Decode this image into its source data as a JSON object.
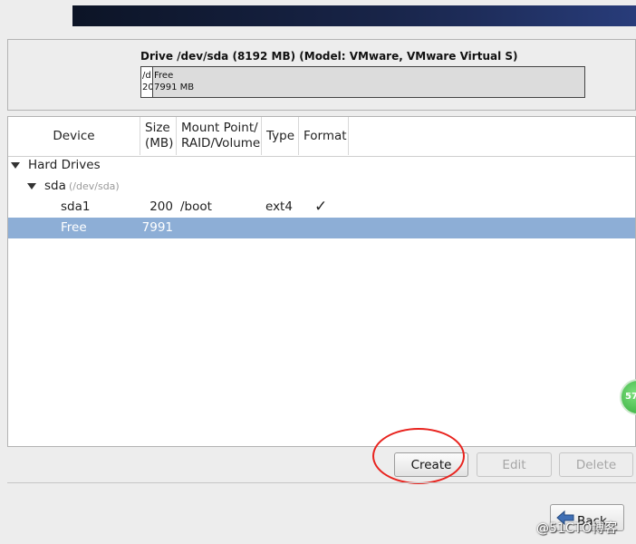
{
  "drive": {
    "title": "Drive /dev/sda (8192 MB) (Model: VMware, VMware Virtual S)",
    "bar": {
      "sda1_top": "/d",
      "sda1_bottom": "20",
      "free_top": "Free",
      "free_bottom": "7991 MB"
    }
  },
  "table": {
    "headers": {
      "device": "Device",
      "size_line1": "Size",
      "size_line2": "(MB)",
      "mount_line1": "Mount Point/",
      "mount_line2": "RAID/Volume",
      "type": "Type",
      "format": "Format"
    },
    "rows": {
      "hard_drives": "Hard Drives",
      "sda": {
        "name": "sda",
        "path": "(/dev/sda)"
      },
      "sda1": {
        "device": "sda1",
        "size": "200",
        "mount": "/boot",
        "type": "ext4",
        "format": "✓"
      },
      "free": {
        "device": "Free",
        "size": "7991"
      }
    }
  },
  "buttons": {
    "create": "Create",
    "edit": "Edit",
    "delete": "Delete",
    "back": "Back"
  },
  "overlay": {
    "badge": "57",
    "watermark": "@51CTO博客"
  },
  "colors": {
    "selection": "#8daed6",
    "annotation": "#e8231e"
  }
}
